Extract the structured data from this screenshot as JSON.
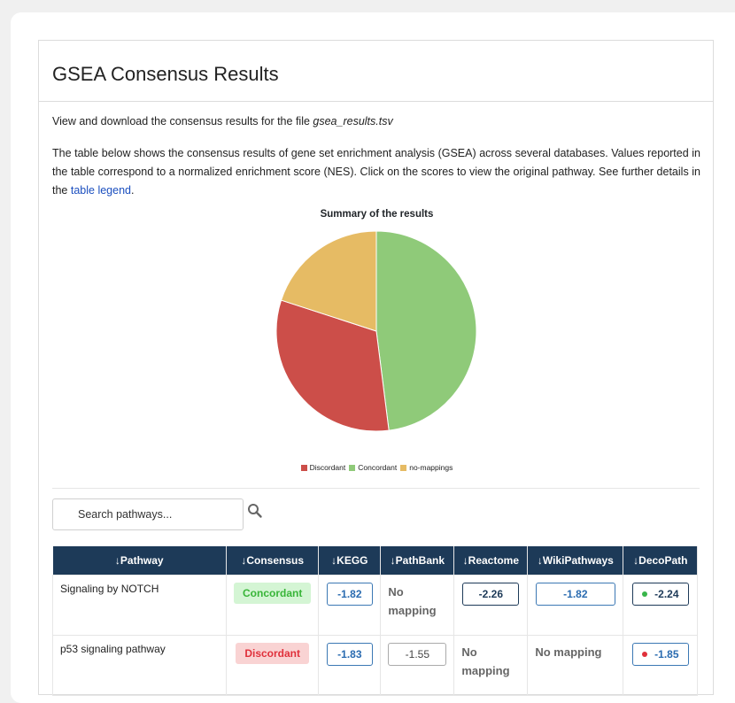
{
  "header": {
    "title": "GSEA Consensus Results"
  },
  "intro": {
    "text_before": "View and download the consensus results for the file ",
    "filename": "gsea_results.tsv"
  },
  "description": {
    "text": "The table below shows the consensus results of gene set enrichment analysis (GSEA) across several databases. Values reported in the table correspond to a normalized enrichment score (NES). Click on the scores to view the original pathway. See further details in the ",
    "link": "table legend",
    "after": "."
  },
  "chart_data": {
    "type": "pie",
    "title": "Summary of the results",
    "categories": [
      "Discordant",
      "Concordant",
      "no-mappings"
    ],
    "values": [
      32,
      48,
      20
    ],
    "colors": [
      "#cc4e49",
      "#8fca79",
      "#e6bb64"
    ],
    "legend_position": "bottom"
  },
  "search": {
    "placeholder": "Search pathways...",
    "icon": "search-icon"
  },
  "table": {
    "headers": [
      "↓Pathway",
      "↓Consensus",
      "↓KEGG",
      "↓PathBank",
      "↓Reactome",
      "↓WikiPathways",
      "↓DecoPath"
    ],
    "rows": [
      {
        "pathway": "Signaling by NOTCH",
        "consensus": "Concordant",
        "kegg": "-1.82",
        "pathbank": "No mapping",
        "reactome": "-2.26",
        "wikipathways": "-1.82",
        "decopath": "-2.24"
      },
      {
        "pathway": "p53 signaling pathway",
        "consensus": "Discordant",
        "kegg": "-1.83",
        "pathbank": "-1.55",
        "reactome": "No mapping",
        "wikipathways": "No mapping",
        "decopath": "-1.85"
      }
    ]
  }
}
